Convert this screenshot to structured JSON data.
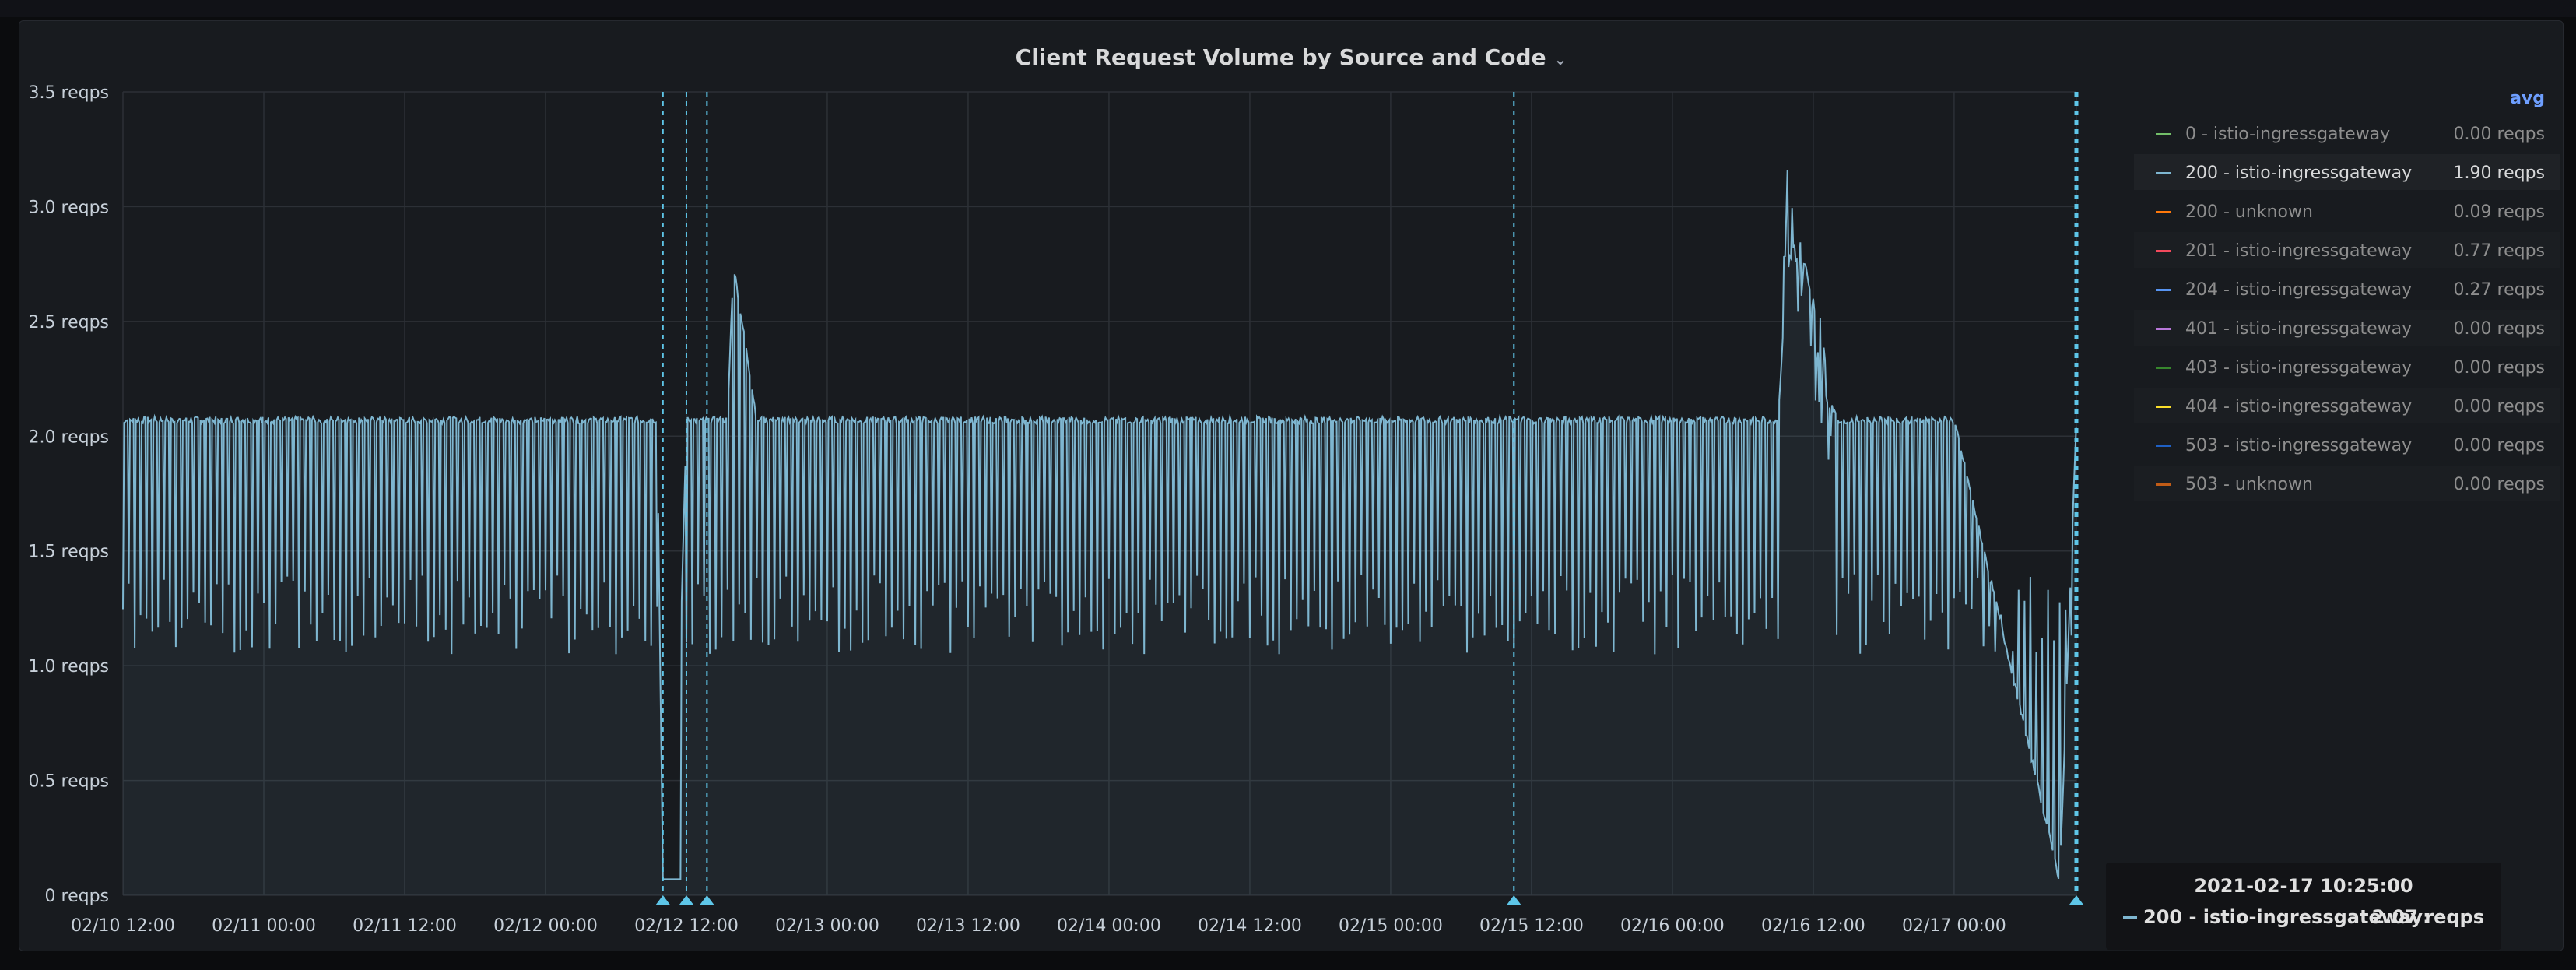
{
  "panel": {
    "title": "Client Request Volume by Source and Code"
  },
  "icons": {
    "title_caret": "chevron-down-icon"
  },
  "colors": {
    "background": "#181b1f",
    "grid": "#2c3036",
    "series_main": "#7eb6d0",
    "annotation": "#5ec6e8",
    "legend_header": "#6e9fff"
  },
  "legend": {
    "header": "avg",
    "items": [
      {
        "name": "0 - istio-ingressgateway",
        "value": "0.00 reqps",
        "color": "#73bf69",
        "active": false
      },
      {
        "name": "200 - istio-ingressgateway",
        "value": "1.90 reqps",
        "color": "#7eb6d0",
        "active": true
      },
      {
        "name": "200 - unknown",
        "value": "0.09 reqps",
        "color": "#ff780a",
        "active": false
      },
      {
        "name": "201 - istio-ingressgateway",
        "value": "0.77 reqps",
        "color": "#f2495c",
        "active": false
      },
      {
        "name": "204 - istio-ingressgateway",
        "value": "0.27 reqps",
        "color": "#5794f2",
        "active": false
      },
      {
        "name": "401 - istio-ingressgateway",
        "value": "0.00 reqps",
        "color": "#b877d9",
        "active": false
      },
      {
        "name": "403 - istio-ingressgateway",
        "value": "0.00 reqps",
        "color": "#37872d",
        "active": false
      },
      {
        "name": "404 - istio-ingressgateway",
        "value": "0.00 reqps",
        "color": "#fade2a",
        "active": false
      },
      {
        "name": "503 - istio-ingressgateway",
        "value": "0.00 reqps",
        "color": "#1f60c4",
        "active": false
      },
      {
        "name": "503 - unknown",
        "value": "0.00 reqps",
        "color": "#c15c17",
        "active": false
      }
    ]
  },
  "tooltip": {
    "time": "2021-02-17 10:25:00",
    "series": "200 - istio-ingressgateway:",
    "value": "2.07 reqps"
  },
  "chart_data": {
    "type": "area",
    "title": "Client Request Volume by Source and Code",
    "xlabel": "",
    "ylabel": "",
    "y_unit": "reqps",
    "ylim": [
      0,
      3.5
    ],
    "y_ticks": [
      0,
      0.5,
      1.0,
      1.5,
      2.0,
      2.5,
      3.0,
      3.5
    ],
    "y_tick_labels": [
      "0 reqps",
      "0.5 reqps",
      "1.0 reqps",
      "1.5 reqps",
      "2.0 reqps",
      "2.5 reqps",
      "3.0 reqps",
      "3.5 reqps"
    ],
    "xlim": [
      "2021-02-10 12:00",
      "2021-02-17 10:25"
    ],
    "x_tick_labels": [
      "02/10 12:00",
      "02/11 00:00",
      "02/11 12:00",
      "02/12 00:00",
      "02/12 12:00",
      "02/13 00:00",
      "02/13 12:00",
      "02/14 00:00",
      "02/14 12:00",
      "02/15 00:00",
      "02/15 12:00",
      "02/16 00:00",
      "02/16 12:00",
      "02/17 00:00"
    ],
    "grid": true,
    "legend_position": "right",
    "series": [
      {
        "name": "200 - istio-ingressgateway",
        "baseline": 2.07,
        "avg": 1.9,
        "x": [
          "2021-02-10 12:00",
          "2021-02-11 00:00",
          "2021-02-11 12:00",
          "2021-02-12 00:00",
          "2021-02-12 09:30",
          "2021-02-12 10:00",
          "2021-02-12 11:00",
          "2021-02-12 12:00",
          "2021-02-12 14:00",
          "2021-02-12 15:30",
          "2021-02-12 16:00",
          "2021-02-12 18:00",
          "2021-02-13 00:00",
          "2021-02-14 00:00",
          "2021-02-15 00:00",
          "2021-02-16 00:00",
          "2021-02-16 09:00",
          "2021-02-16 10:00",
          "2021-02-16 11:00",
          "2021-02-16 12:00",
          "2021-02-16 13:00",
          "2021-02-16 14:00",
          "2021-02-17 00:00",
          "2021-02-17 09:00",
          "2021-02-17 10:25"
        ],
        "y": [
          2.07,
          2.07,
          2.07,
          2.07,
          2.07,
          0.07,
          0.07,
          2.07,
          2.07,
          2.07,
          2.75,
          2.07,
          2.07,
          2.07,
          2.07,
          2.07,
          2.07,
          2.95,
          3.0,
          2.5,
          2.25,
          2.07,
          2.07,
          0.06,
          2.07
        ]
      }
    ],
    "dip_pattern": {
      "period_minutes": 30,
      "low_range": [
        1.05,
        1.4
      ]
    },
    "annotations": [
      "2021-02-12 10:00",
      "2021-02-12 12:00",
      "2021-02-12 13:45",
      "2021-02-15 10:30",
      "2021-02-17 10:25"
    ]
  }
}
